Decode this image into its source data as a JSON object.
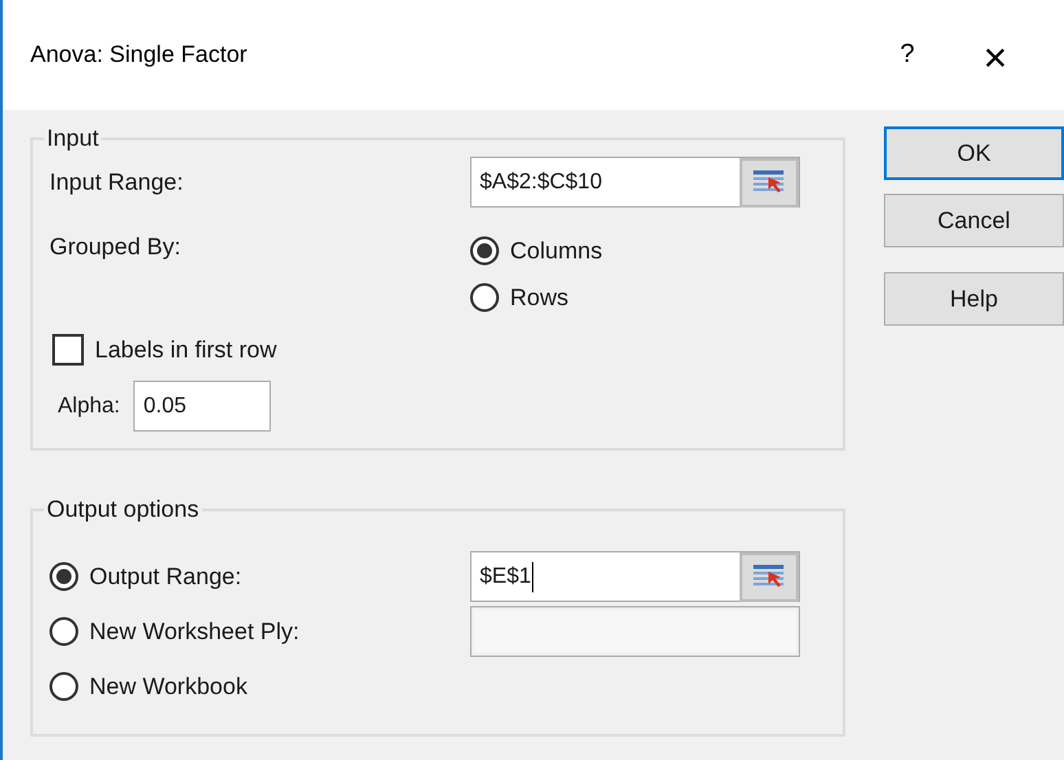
{
  "window": {
    "title": "Anova: Single Factor",
    "help": "?",
    "close": "×"
  },
  "input": {
    "title": "Input",
    "input_range": {
      "label": "Input Range:",
      "value": "$A$2:$C$10"
    },
    "grouped_by": {
      "label": "Grouped By:",
      "options": [
        {
          "label": "Columns",
          "selected": true
        },
        {
          "label": "Rows",
          "selected": false
        }
      ]
    },
    "labels_checkbox": {
      "label": "Labels in first row",
      "checked": false
    },
    "alpha": {
      "label": "Alpha:",
      "value": "0.05"
    }
  },
  "output": {
    "title": "Output options",
    "options": [
      {
        "label": "Output Range:",
        "selected": true,
        "field": {
          "value": "$E$1",
          "disabled": false,
          "focused": true,
          "picker": true
        }
      },
      {
        "label": "New Worksheet Ply:",
        "selected": false,
        "field": {
          "disabled": true,
          "focused": false,
          "picker": false
        }
      },
      {
        "label": "New Workbook",
        "selected": false
      }
    ]
  },
  "buttons": [
    {
      "label": "OK",
      "default": true
    },
    {
      "label": "Cancel",
      "default": false
    },
    {
      "label": "Help",
      "default": false
    }
  ]
}
